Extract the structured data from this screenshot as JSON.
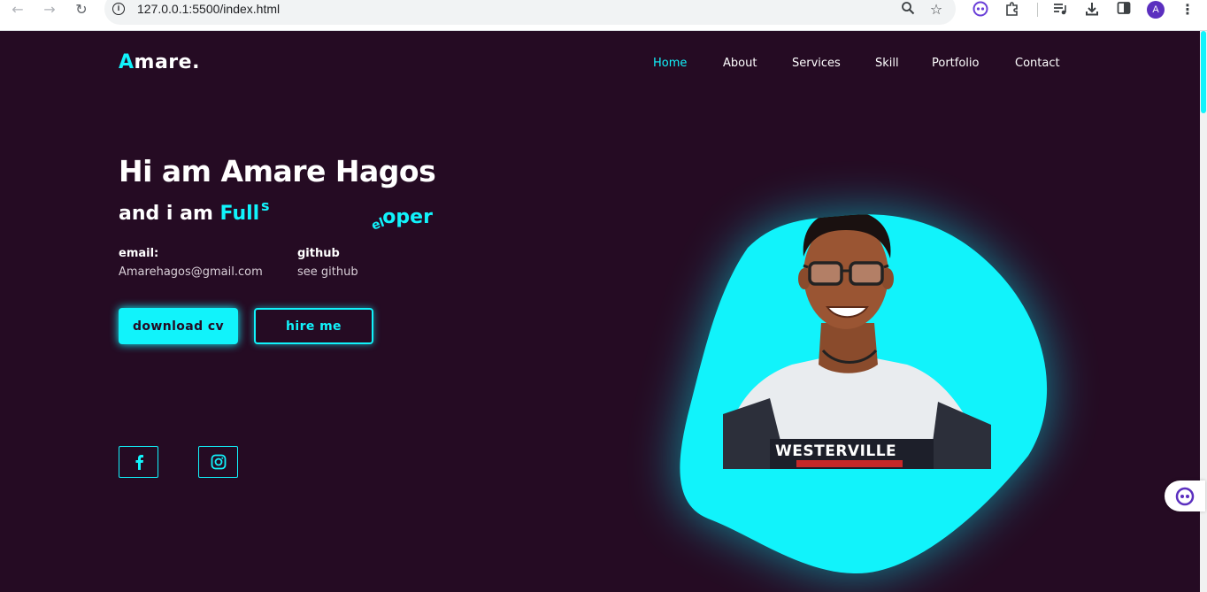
{
  "browser": {
    "url": "127.0.0.1:5500/index.html",
    "profile_initial": "A",
    "icons": [
      "back-icon",
      "forward-icon",
      "reload-icon",
      "info-icon",
      "zoom-icon",
      "star-icon",
      "extension-bot-icon",
      "puzzle-icon",
      "media-icon",
      "download-icon",
      "sidebar-icon",
      "kebab-menu-icon"
    ]
  },
  "logo": {
    "accent": "A",
    "rest": "mare."
  },
  "nav": {
    "items": [
      {
        "label": "Home",
        "active": true
      },
      {
        "label": "About"
      },
      {
        "label": "Services"
      },
      {
        "label": "Skill"
      },
      {
        "label": "Portfolio"
      },
      {
        "label": "Contact"
      }
    ]
  },
  "hero": {
    "title": "Hi am Amare Hagos",
    "subtitle_prefix": "and i am ",
    "role_visible": "Full",
    "role_fragment_s": "s",
    "role_tail_rot": "el",
    "role_tail": "oper"
  },
  "info": {
    "email_label": "email:",
    "email_value": "Amarehagos@gmail.com",
    "github_label": "github",
    "github_value": "see github"
  },
  "buttons": {
    "download": "download cv",
    "hire": "hire me"
  },
  "social": [
    "facebook-icon",
    "instagram-icon"
  ],
  "photo_shirt_text": "WESTERVILLE",
  "colors": {
    "background": "#250b23",
    "accent": "#11f3fb",
    "text": "#ffffff"
  }
}
